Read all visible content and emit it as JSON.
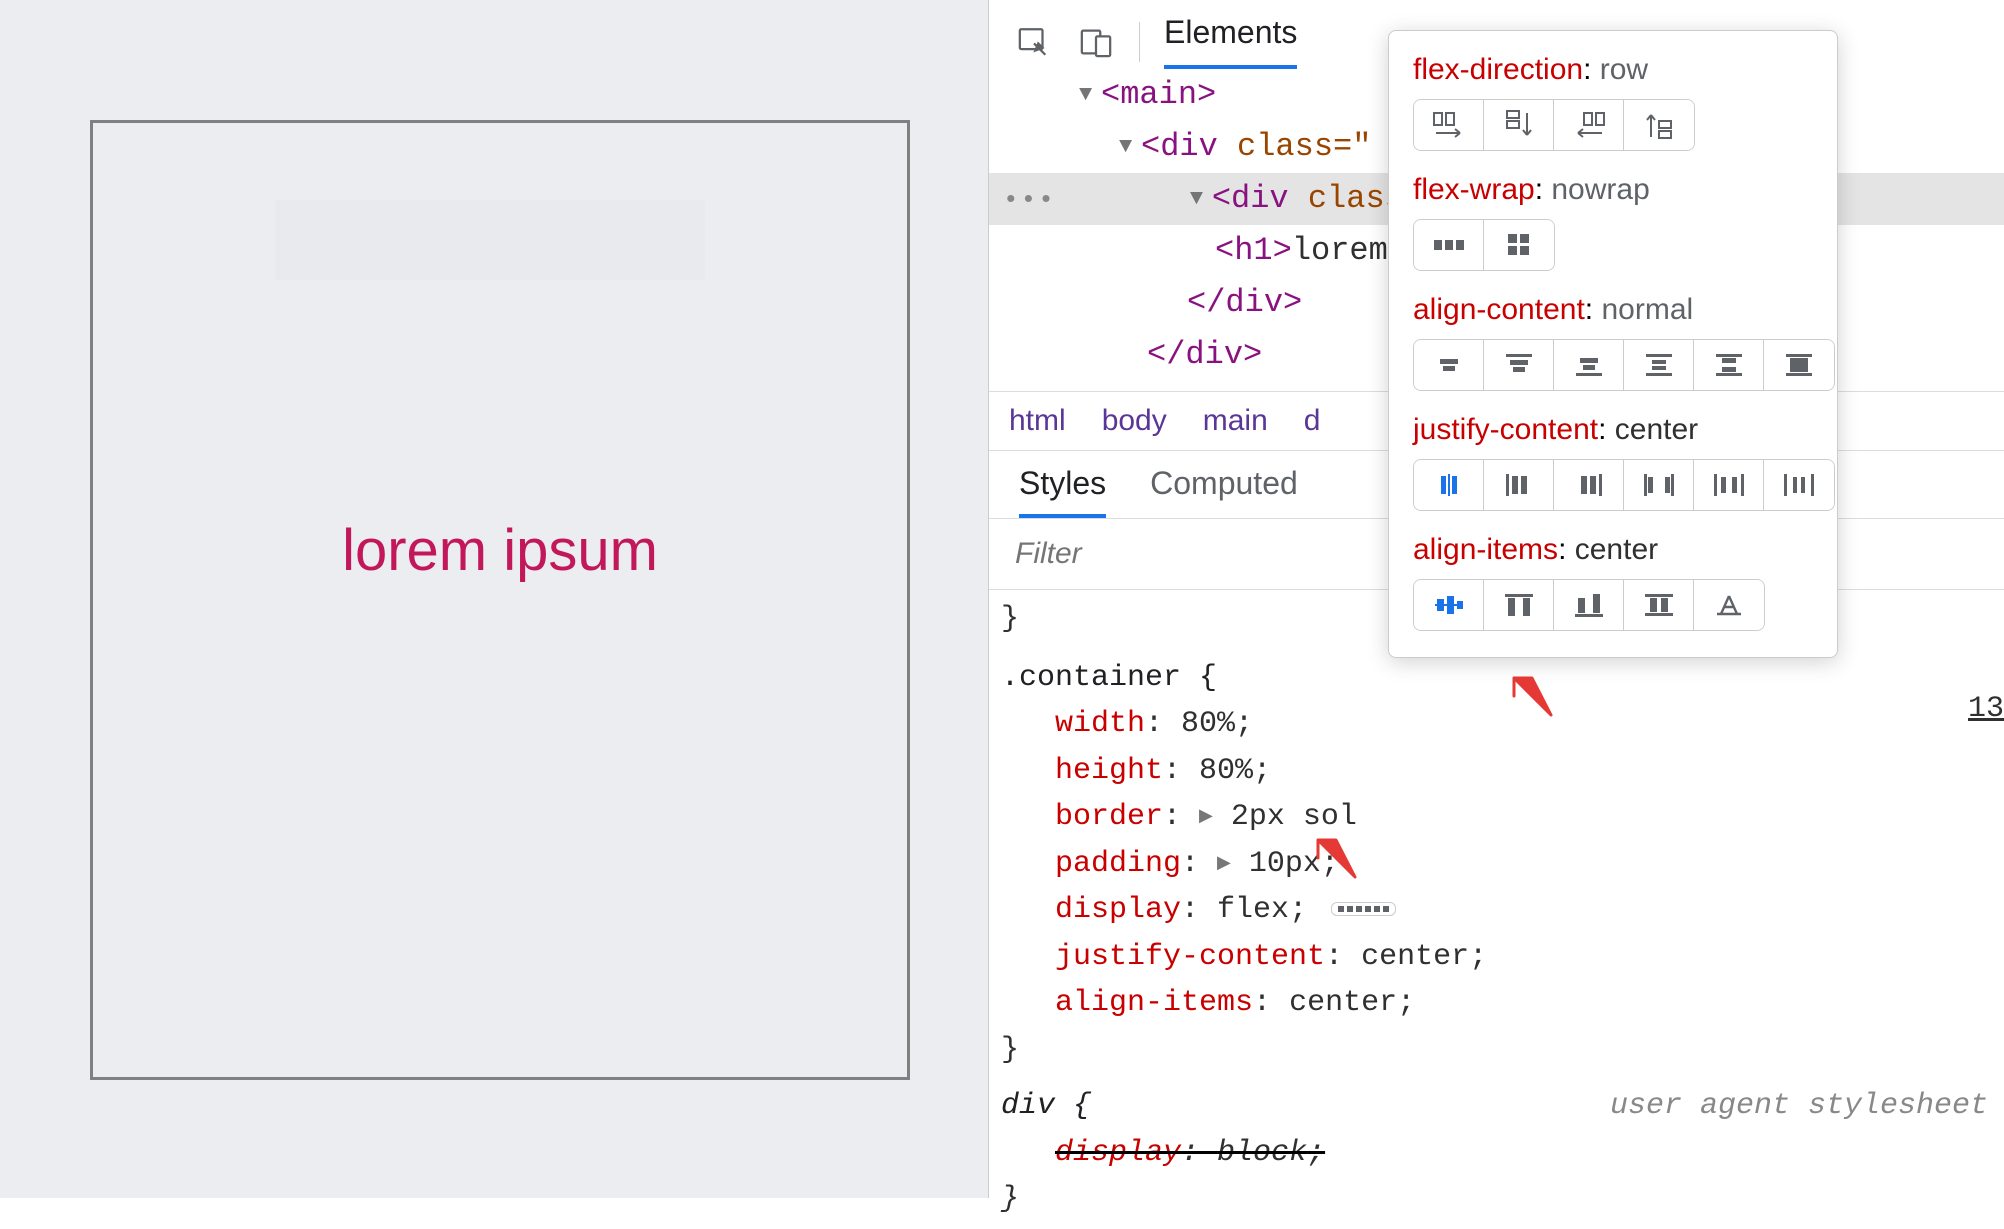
{
  "viewport": {
    "demo_text": "lorem ipsum"
  },
  "devtools": {
    "tabs": {
      "elements": "Elements"
    },
    "dom": {
      "r0": "<main>",
      "r1_open": "<div",
      "r1_attr": " class=\"",
      "r1_tail": "",
      "r2_open": "<div",
      "r2_attr": " class=",
      "r2_tail": "",
      "r3_open": "<h1>",
      "r3_text": "lorem",
      "r3_tail": "",
      "r4": "</div>",
      "r5": "</div>"
    },
    "breadcrumb": {
      "b0": "html",
      "b1": "body",
      "b2": "main",
      "b3": "d"
    },
    "sub_tabs": {
      "styles": "Styles",
      "computed": "Computed"
    },
    "filter_ph": "Filter",
    "css": {
      "selector": ".container {",
      "p_width": "width",
      "v_width": "80%",
      "p_height": "height",
      "v_height": "80%",
      "p_border": "border",
      "v_border": "2px sol",
      "p_padding": "padding",
      "v_padding": "10px",
      "p_display": "display",
      "v_display": "flex",
      "p_jc": "justify-content",
      "v_jc": "center",
      "p_ai": "align-items",
      "v_ai": "center",
      "close": "}",
      "ua_sel": "div {",
      "ua_label": "user agent stylesheet",
      "ua_p": "display",
      "ua_v": "block",
      "thirteen": "13"
    }
  },
  "popup": {
    "flex_direction": {
      "name": "flex-direction",
      "value": "row"
    },
    "flex_wrap": {
      "name": "flex-wrap",
      "value": "nowrap"
    },
    "align_content": {
      "name": "align-content",
      "value": "normal"
    },
    "justify_content": {
      "name": "justify-content",
      "value": "center"
    },
    "align_items": {
      "name": "align-items",
      "value": "center"
    }
  }
}
